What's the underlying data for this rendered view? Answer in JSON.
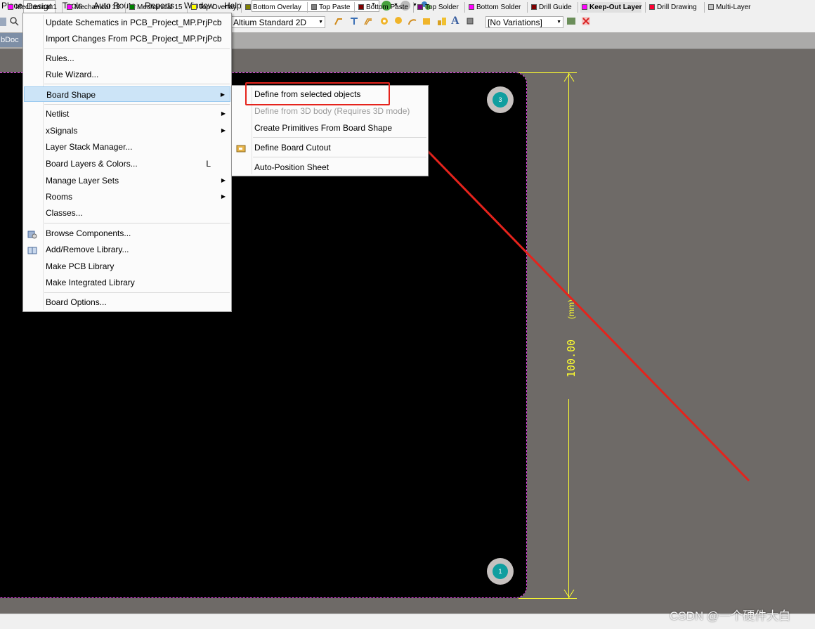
{
  "menubar": {
    "items": [
      "Place",
      "Design",
      "Tools",
      "Auto Route",
      "Reports",
      "Window",
      "Help"
    ],
    "active": "Design"
  },
  "toolbar": {
    "view_config": "Altium Standard 2D",
    "variations": "[No Variations]"
  },
  "document_tab": "bDoc *",
  "design_menu": {
    "items": [
      {
        "label": "Update Schematics in PCB_Project_MP.PrjPcb"
      },
      {
        "label": "Import Changes From PCB_Project_MP.PrjPcb"
      },
      {
        "label": "Rules..."
      },
      {
        "label": "Rule Wizard..."
      },
      {
        "label": "Board Shape",
        "submenu": true,
        "highlighted": true
      },
      {
        "label": "Netlist",
        "submenu": true
      },
      {
        "label": "xSignals",
        "submenu": true
      },
      {
        "label": "Layer Stack Manager..."
      },
      {
        "label": "Board Layers & Colors...",
        "shortcut": "L"
      },
      {
        "label": "Manage Layer Sets",
        "submenu": true
      },
      {
        "label": "Rooms",
        "submenu": true
      },
      {
        "label": "Classes..."
      },
      {
        "label": "Browse Components...",
        "icon": "components-icon"
      },
      {
        "label": "Add/Remove Library...",
        "icon": "library-icon"
      },
      {
        "label": "Make PCB Library"
      },
      {
        "label": "Make Integrated Library"
      },
      {
        "label": "Board Options..."
      }
    ]
  },
  "board_shape_submenu": {
    "items": [
      {
        "label": "Define from selected objects",
        "annotated": true
      },
      {
        "label": "Define from 3D body (Requires 3D mode)",
        "disabled": true
      },
      {
        "label": "Create Primitives From Board Shape"
      },
      {
        "label": "Define Board Cutout",
        "icon": "cutout-icon"
      },
      {
        "label": "Auto-Position Sheet"
      }
    ]
  },
  "canvas": {
    "mounting_holes": [
      "3",
      "1"
    ],
    "dimension_value": "100.00",
    "dimension_unit": "(mm)"
  },
  "layer_tabs": [
    {
      "label": "Mechanical 1",
      "color": "#ff00ff"
    },
    {
      "label": "Mechanical 13",
      "color": "#ff00ff"
    },
    {
      "label": "Mechanical 15",
      "color": "#008000"
    },
    {
      "label": "Top Overlay",
      "color": "#ffff00"
    },
    {
      "label": "Bottom Overlay",
      "color": "#808000"
    },
    {
      "label": "Top Paste",
      "color": "#808080"
    },
    {
      "label": "Bottom Paste",
      "color": "#800000"
    },
    {
      "label": "Top Solder",
      "color": "#800080"
    },
    {
      "label": "Bottom Solder",
      "color": "#ff00ff"
    },
    {
      "label": "Drill Guide",
      "color": "#800000"
    },
    {
      "label": "Keep-Out Layer",
      "color": "#ff00ff",
      "active": true
    },
    {
      "label": "Drill Drawing",
      "color": "#ff0033"
    },
    {
      "label": "Multi-Layer",
      "color": "#c0c0c0"
    }
  ],
  "watermark": "CSDN @一个硬件大白",
  "colors": {
    "board": "#000000",
    "workspace": "#6e6a67",
    "board_outline": "#e33fe6",
    "dimension": "#ffff2e",
    "pad": "#109e9f",
    "annotation": "#e5231c",
    "menu_highlight": "#cce4f7"
  }
}
